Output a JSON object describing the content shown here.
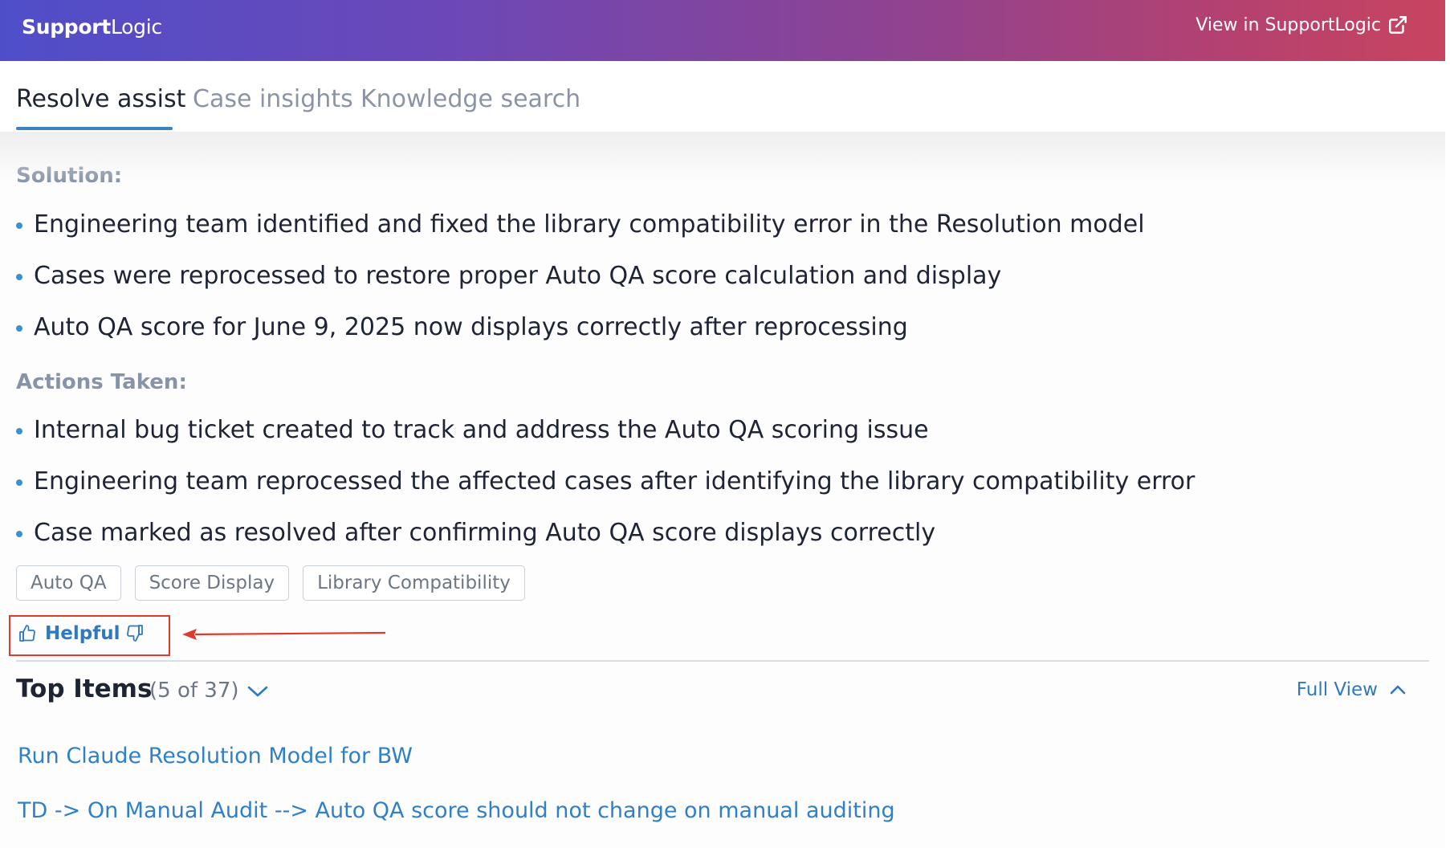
{
  "header": {
    "brand_bold": "Support",
    "brand_light": "Logic",
    "view_link": "View in SupportLogic"
  },
  "tabs": [
    {
      "label": "Resolve assist",
      "active": true
    },
    {
      "label": "Case insights",
      "active": false
    },
    {
      "label": "Knowledge search",
      "active": false
    }
  ],
  "solution": {
    "label": "Solution:",
    "items": [
      "Engineering team identified and fixed the library compatibility error in the Resolution model",
      "Cases were reprocessed to restore proper Auto QA score calculation and display",
      "Auto QA score for June 9, 2025 now displays correctly after reprocessing"
    ]
  },
  "actions": {
    "label": "Actions Taken:",
    "items": [
      "Internal bug ticket created to track and address the Auto QA scoring issue",
      "Engineering team reprocessed the affected cases after identifying the library compatibility error",
      "Case marked as resolved after confirming Auto QA score displays correctly"
    ]
  },
  "tags": [
    "Auto QA",
    "Score Display",
    "Library Compatibility"
  ],
  "feedback": {
    "helpful_label": "Helpful"
  },
  "top_items": {
    "title": "Top Items",
    "count": "(5 of 37)",
    "full_view": "Full View",
    "links": [
      "Run Claude Resolution Model for BW",
      "TD -> On Manual Audit --> Auto QA score should not change on manual auditing"
    ]
  },
  "colors": {
    "accent": "#2f78c2",
    "highlight_box": "#e03a2e"
  }
}
